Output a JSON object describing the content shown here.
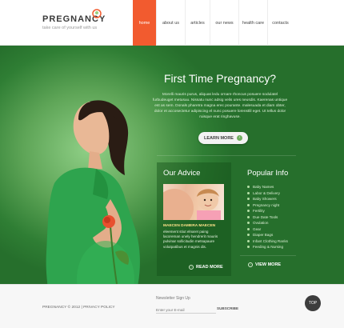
{
  "header": {
    "logo_title": "PREGNANCY",
    "logo_tagline": "take care of yourself with us",
    "nav": [
      {
        "label": "home",
        "active": true
      },
      {
        "label": "about us",
        "active": false
      },
      {
        "label": "articles",
        "active": false
      },
      {
        "label": "our news",
        "active": false
      },
      {
        "label": "health care",
        "active": false
      },
      {
        "label": "contacts",
        "active": false
      }
    ]
  },
  "hero": {
    "title": "First Time Pregnancy?",
    "text": "Morelli mauris purus, aliquas ledu ornare rhoncus posuere sodulatel furbudeuget metusuu. Nissatu nunc adsig velis ures neusdis. Kaerenas untique est as sem. Donals pharetra magna erec pourante. malesuada et diam obter, dolor et accosectetur adipiscing el nunc posuere lorenstlil eget. Ut tellus dolor ruisque erat ringhavuse.",
    "learn_more": "LEARN MORE"
  },
  "advice": {
    "title": "Our Advice",
    "subtitle": "MAECEN DAMERA MAECEN",
    "body": "eleement stiut elnaret paing lacoreman unely hendrerit mauris pulvinar sollicitudin metsapaure volutpatibus et magnis dis.",
    "read_more": "READ MORE"
  },
  "popular": {
    "title": "Popular Info",
    "items": [
      "Baby Names",
      "Labor & Delivery",
      "Baby Showers",
      "Pregnancy night",
      "Fertility",
      "Due Date Tools",
      "Ovulation",
      "Gear",
      "Diaper Bags",
      "Infant Clothing Ranks",
      "Feeding & Nursing"
    ],
    "view_more": "VIEW MORE"
  },
  "footer": {
    "copyright": "PREGNANCY © 2012 | PRIVACY POLICY",
    "newsletter_label": "Newsletter Sign Up",
    "email_placeholder": "Enter your E-mail",
    "subscribe": "SUBSCRIBE",
    "top": "TOP"
  },
  "colors": {
    "accent": "#f25b2f",
    "hero_green": "#4d9a47",
    "dark_green": "#266f2c"
  }
}
